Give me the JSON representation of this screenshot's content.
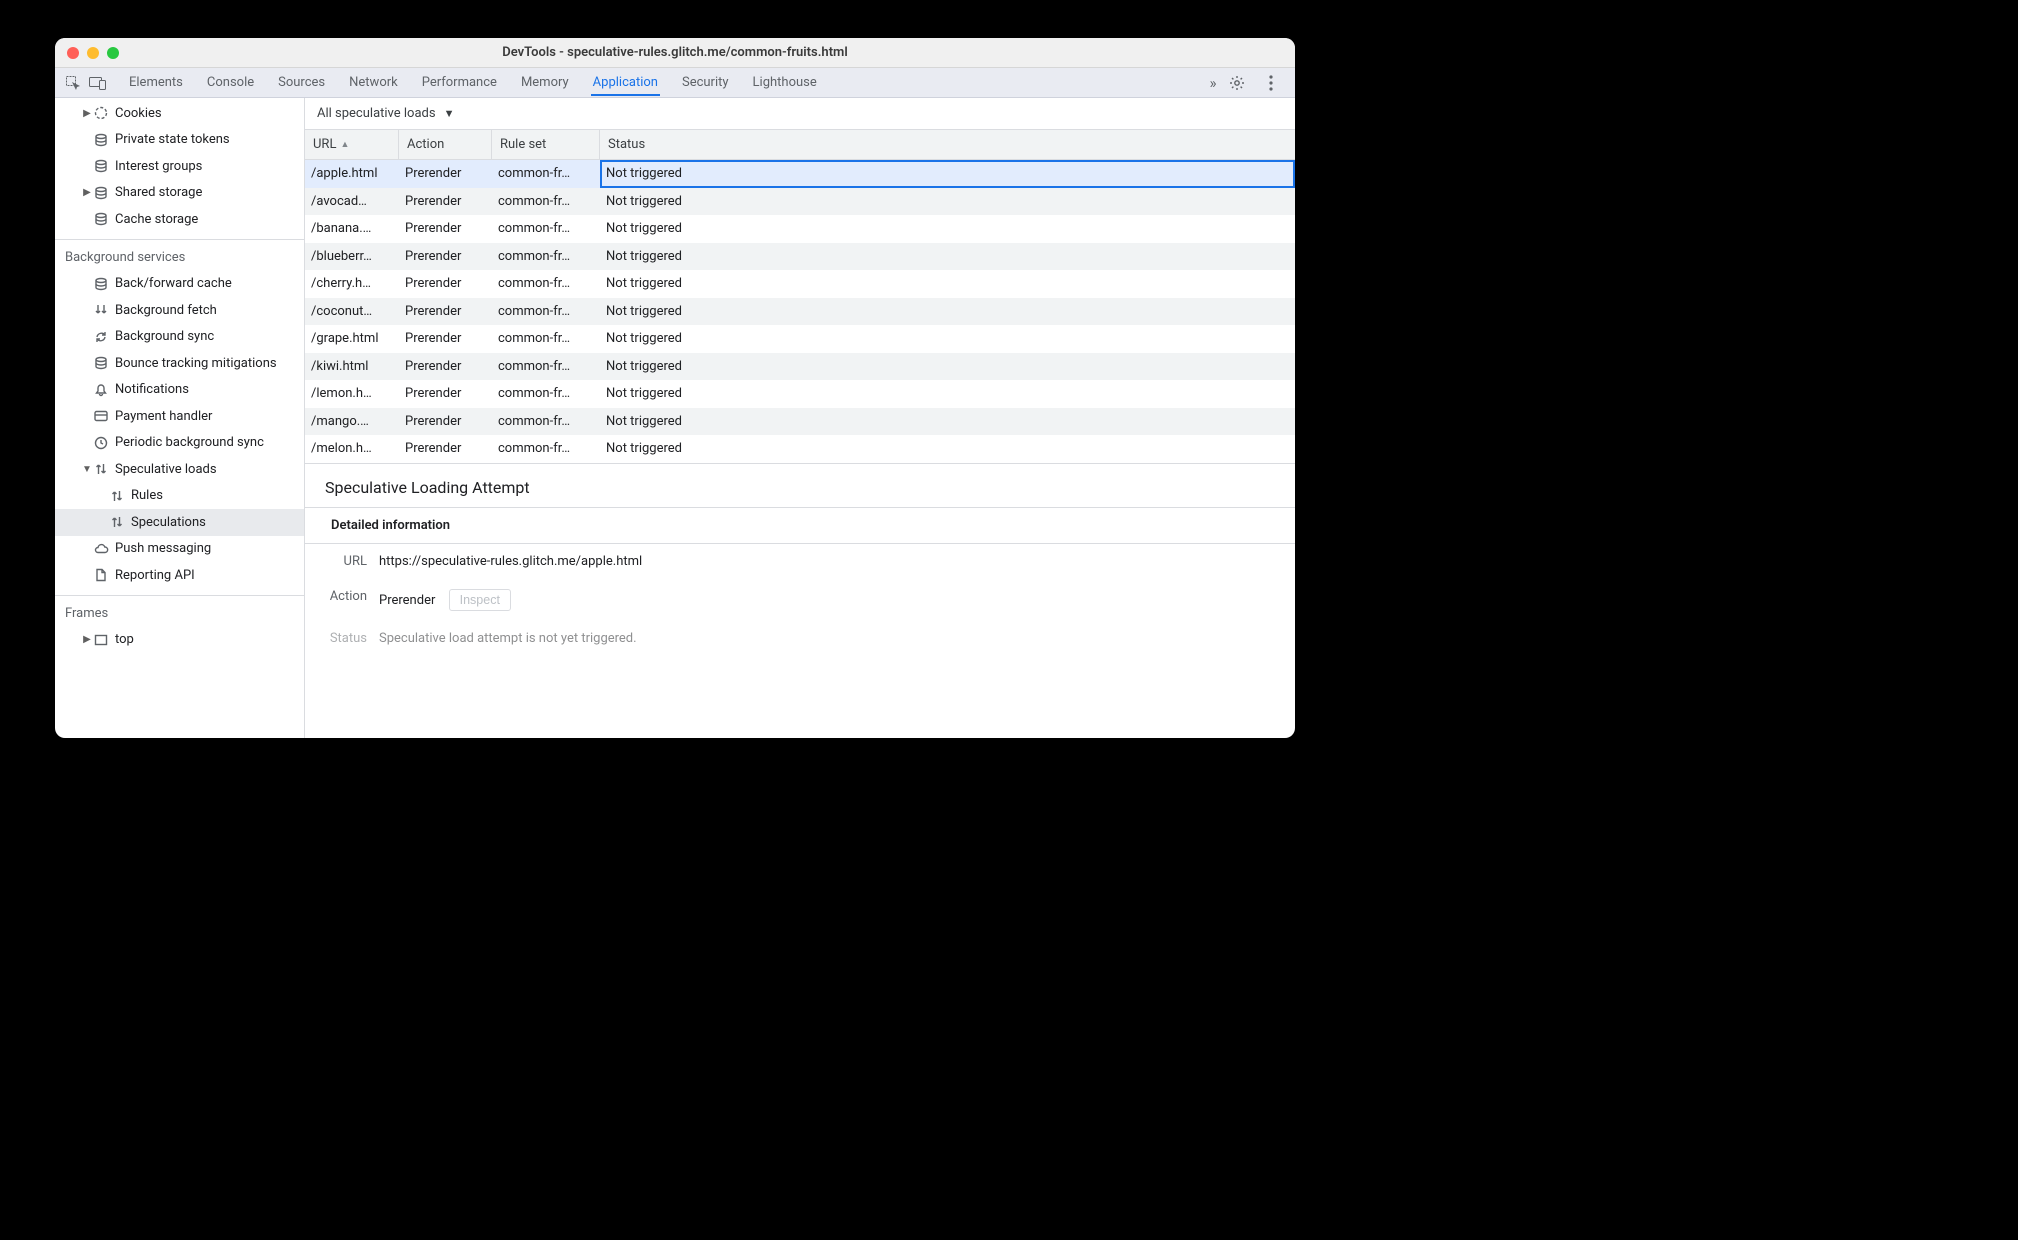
{
  "window": {
    "title": "DevTools - speculative-rules.glitch.me/common-fruits.html"
  },
  "tabs": {
    "items": [
      "Elements",
      "Console",
      "Sources",
      "Network",
      "Performance",
      "Memory",
      "Application",
      "Security",
      "Lighthouse"
    ],
    "active": "Application",
    "overflow": "»"
  },
  "sidebar": {
    "group1": [
      {
        "icon": "cookie-icon",
        "label": "Cookies",
        "indent": 22,
        "chev": "▶"
      },
      {
        "icon": "db-icon",
        "label": "Private state tokens",
        "indent": 34
      },
      {
        "icon": "db-icon",
        "label": "Interest groups",
        "indent": 34
      },
      {
        "icon": "db-icon",
        "label": "Shared storage",
        "indent": 22,
        "chev": "▶"
      },
      {
        "icon": "db-icon",
        "label": "Cache storage",
        "indent": 34
      }
    ],
    "section2_title": "Background services",
    "group2": [
      {
        "icon": "db-icon",
        "label": "Back/forward cache",
        "indent": 34
      },
      {
        "icon": "arrows-down-icon",
        "label": "Background fetch",
        "indent": 34
      },
      {
        "icon": "sync-icon",
        "label": "Background sync",
        "indent": 34
      },
      {
        "icon": "db-icon",
        "label": "Bounce tracking mitigations",
        "indent": 34
      },
      {
        "icon": "bell-icon",
        "label": "Notifications",
        "indent": 34
      },
      {
        "icon": "card-icon",
        "label": "Payment handler",
        "indent": 34
      },
      {
        "icon": "clock-icon",
        "label": "Periodic background sync",
        "indent": 34
      },
      {
        "icon": "arrows-updown-icon",
        "label": "Speculative loads",
        "indent": 22,
        "chev": "▼"
      },
      {
        "icon": "arrows-updown-icon",
        "label": "Rules",
        "indent": 50
      },
      {
        "icon": "arrows-updown-icon",
        "label": "Speculations",
        "indent": 50,
        "selected": true
      },
      {
        "icon": "cloud-icon",
        "label": "Push messaging",
        "indent": 34
      },
      {
        "icon": "file-icon",
        "label": "Reporting API",
        "indent": 34
      }
    ],
    "section3_title": "Frames",
    "group3": [
      {
        "icon": "frame-icon",
        "label": "top",
        "indent": 22,
        "chev": "▶"
      }
    ]
  },
  "filter": {
    "label": "All speculative loads"
  },
  "columns": {
    "url": "URL",
    "action": "Action",
    "rule": "Rule set",
    "status": "Status"
  },
  "rows": [
    {
      "url": "/apple.html",
      "action": "Prerender",
      "rule": "common-fr…",
      "status": "Not triggered",
      "selected": true
    },
    {
      "url": "/avocad…",
      "action": "Prerender",
      "rule": "common-fr…",
      "status": "Not triggered"
    },
    {
      "url": "/banana.…",
      "action": "Prerender",
      "rule": "common-fr…",
      "status": "Not triggered"
    },
    {
      "url": "/blueberr…",
      "action": "Prerender",
      "rule": "common-fr…",
      "status": "Not triggered"
    },
    {
      "url": "/cherry.h…",
      "action": "Prerender",
      "rule": "common-fr…",
      "status": "Not triggered"
    },
    {
      "url": "/coconut…",
      "action": "Prerender",
      "rule": "common-fr…",
      "status": "Not triggered"
    },
    {
      "url": "/grape.html",
      "action": "Prerender",
      "rule": "common-fr…",
      "status": "Not triggered"
    },
    {
      "url": "/kiwi.html",
      "action": "Prerender",
      "rule": "common-fr…",
      "status": "Not triggered"
    },
    {
      "url": "/lemon.h…",
      "action": "Prerender",
      "rule": "common-fr…",
      "status": "Not triggered"
    },
    {
      "url": "/mango.…",
      "action": "Prerender",
      "rule": "common-fr…",
      "status": "Not triggered"
    },
    {
      "url": "/melon.h…",
      "action": "Prerender",
      "rule": "common-fr…",
      "status": "Not triggered"
    }
  ],
  "details": {
    "heading": "Speculative Loading Attempt",
    "section": "Detailed information",
    "url_label": "URL",
    "url": "https://speculative-rules.glitch.me/apple.html",
    "action_label": "Action",
    "action": "Prerender",
    "inspect": "Inspect",
    "status_label": "Status",
    "status": "Speculative load attempt is not yet triggered."
  }
}
